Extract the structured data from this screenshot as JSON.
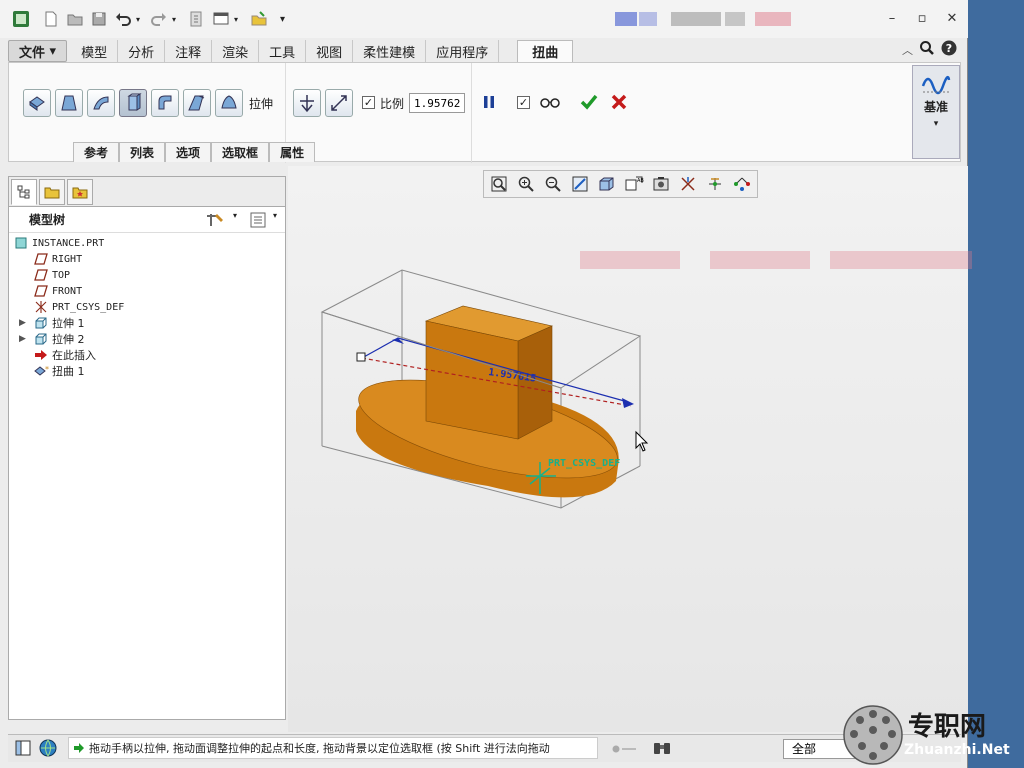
{
  "titlebar": {
    "quick_access": [
      "app-logo-icon",
      "new-icon",
      "open-icon",
      "save-icon",
      "undo-icon",
      "redo-icon",
      "regenerate-icon",
      "windows-icon",
      "close-window-icon",
      "customize-icon"
    ]
  },
  "ribbon_tabs": [
    {
      "label": "文件",
      "type": "file"
    },
    {
      "label": "模型"
    },
    {
      "label": "分析"
    },
    {
      "label": "注释"
    },
    {
      "label": "渲染"
    },
    {
      "label": "工具"
    },
    {
      "label": "视图"
    },
    {
      "label": "柔性建模"
    },
    {
      "label": "应用程序"
    },
    {
      "label": "扭曲",
      "active": true
    }
  ],
  "file_arrow": "▾",
  "twist_toolbar": {
    "stretch_label": "拉伸",
    "ratio_label": "比例",
    "ratio_value": "1.95762",
    "ratio_checked": true,
    "preview_checked": true
  },
  "subtabs": [
    "参考",
    "列表",
    "选项",
    "选取框",
    "属性"
  ],
  "datum_label": "基准",
  "model_tree": {
    "title": "模型树",
    "items": [
      {
        "label": "INSTANCE.PRT",
        "icon": "part-icon",
        "indent": 0
      },
      {
        "label": "RIGHT",
        "icon": "datum-plane-icon",
        "indent": 1
      },
      {
        "label": "TOP",
        "icon": "datum-plane-icon",
        "indent": 1
      },
      {
        "label": "FRONT",
        "icon": "datum-plane-icon",
        "indent": 1
      },
      {
        "label": "PRT_CSYS_DEF",
        "icon": "csys-icon",
        "indent": 1
      },
      {
        "label": "拉伸 1",
        "icon": "extrude-icon",
        "indent": 1,
        "expandable": true
      },
      {
        "label": "拉伸 2",
        "icon": "extrude-icon",
        "indent": 1,
        "expandable": true
      },
      {
        "label": "在此插入",
        "icon": "insert-here-icon",
        "indent": 1
      },
      {
        "label": "扭曲 1",
        "icon": "twist-icon",
        "indent": 1
      }
    ]
  },
  "viewport": {
    "dimension_label": "1.957615",
    "csys_label": "PRT_CSYS_DEF",
    "colors": {
      "body": "#c9780f",
      "bbox": "#8a8a8a",
      "axis": "#1c2fb0",
      "ref_line": "#b02020",
      "csys": "#19b08a"
    }
  },
  "statusbar": {
    "message": "拖动手柄以拉伸, 拖动面调整拉伸的起点和长度, 拖动背景以定位选取框 (按 Shift 进行法向拖动",
    "filter_value": "全部"
  },
  "watermark": {
    "text": "专职网",
    "url_text": "Zhuanzhi.Net"
  }
}
